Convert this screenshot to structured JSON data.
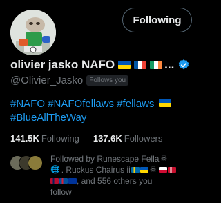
{
  "header": {
    "follow_button_label": "Following"
  },
  "profile": {
    "display_name": "olivier jasko NAFO",
    "name_flags": [
      "ukraine-flag-icon",
      "france-flag-icon",
      "ireland-flag-icon"
    ],
    "name_truncation": "...",
    "verified": true,
    "handle": "@Olivier_Jasko",
    "follows_you_label": "Follows you"
  },
  "bio": {
    "line1_tags": [
      "#NAFO",
      "#NAFOfellaws",
      "#fellaws"
    ],
    "line1_flag": "ukraine-flag-icon",
    "line2_tag": "#BlueAllTheWay"
  },
  "stats": {
    "following_count": "141.5K",
    "following_label": "Following",
    "followers_count": "137.6K",
    "followers_label": "Followers"
  },
  "followed_by": {
    "line1": "Followed by Runescape Fella",
    "line2_name": ". Ruckus Chairus ii",
    "line3_suffix": ", and 556 others you",
    "line4": "follow"
  },
  "colors": {
    "background": "#000000",
    "text_primary": "#e7e9ea",
    "text_secondary": "#71767b",
    "link": "#1d9bf0",
    "verified": "#1d9bf0"
  }
}
